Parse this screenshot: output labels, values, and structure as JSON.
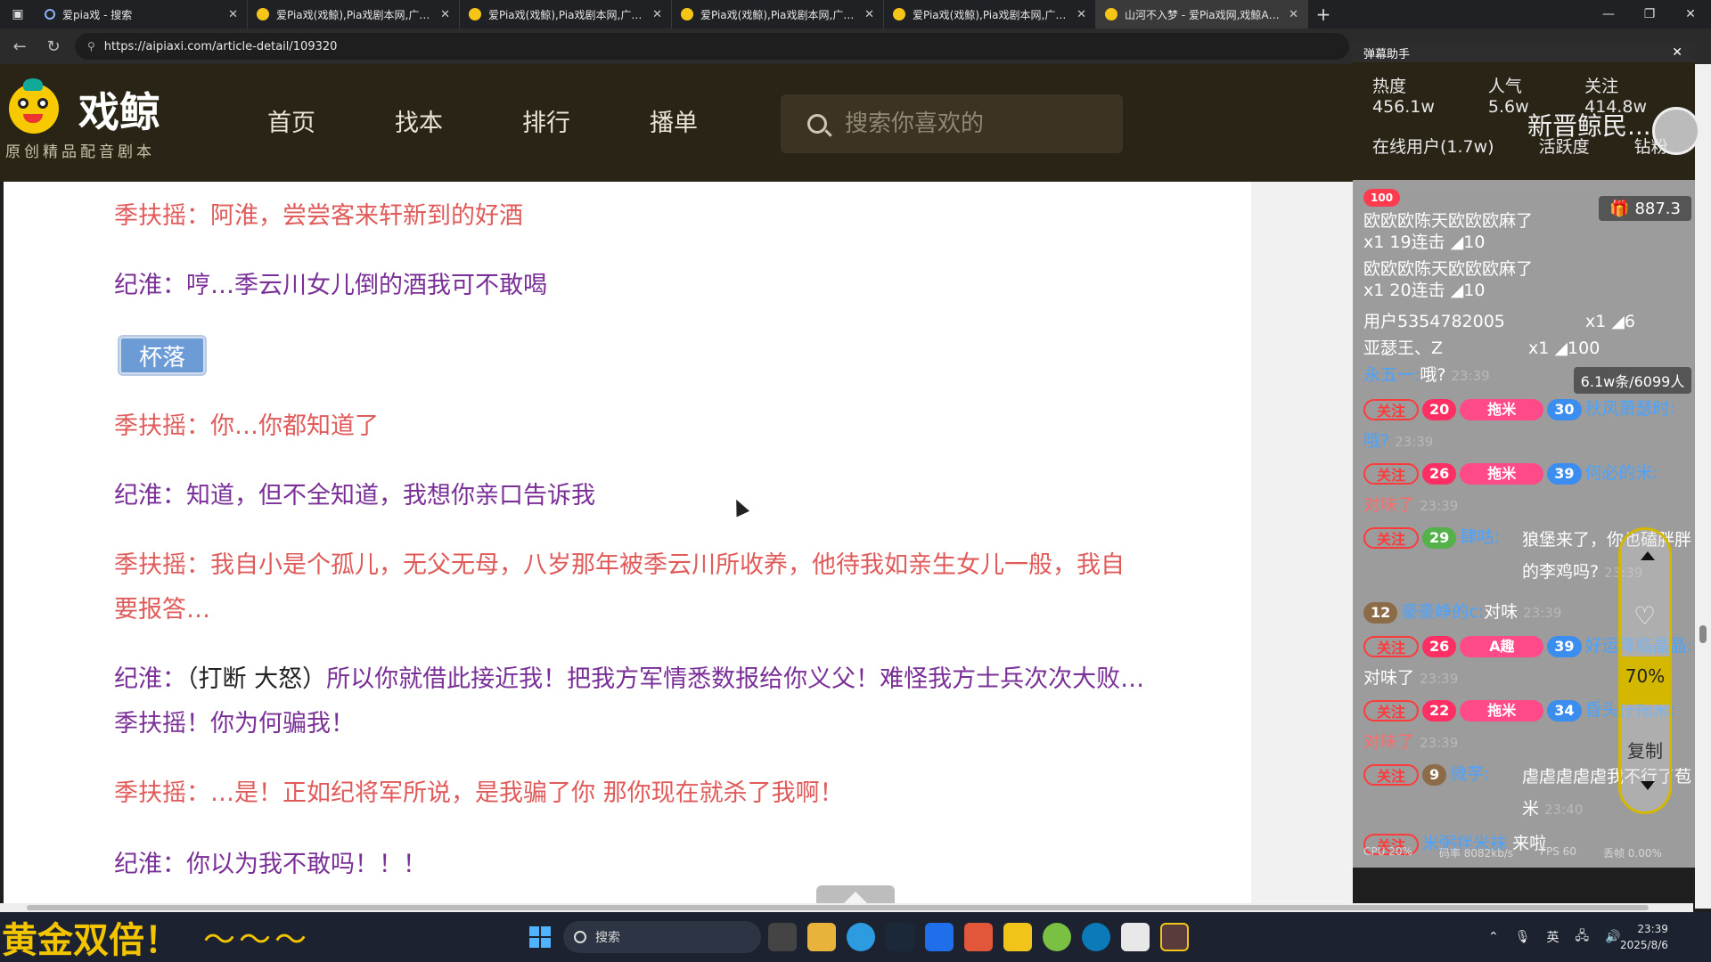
{
  "browser": {
    "tabs": [
      {
        "title": "爱pia戏 - 搜索",
        "active": false,
        "icon": "search-icon"
      },
      {
        "title": "爱Pia戏(戏鲸),Pia戏剧本网,广播剧",
        "active": false,
        "icon": "mascot-icon"
      },
      {
        "title": "爱Pia戏(戏鲸),Pia戏剧本网,广播剧",
        "active": false,
        "icon": "mascot-icon"
      },
      {
        "title": "爱Pia戏(戏鲸),Pia戏剧本网,广播剧",
        "active": false,
        "icon": "mascot-icon"
      },
      {
        "title": "爱Pia戏(戏鲸),Pia戏剧本网,广播剧",
        "active": false,
        "icon": "mascot-icon"
      },
      {
        "title": "山河不入梦 - 爱Pia戏网,戏鲸App,",
        "active": true,
        "icon": "mascot-icon"
      }
    ],
    "url": "https://aipiaxi.com/article-detail/109320"
  },
  "site": {
    "logo_name": "戏鲸",
    "logo_sub": "原创精品配音剧本",
    "nav": [
      "首页",
      "找本",
      "排行",
      "播单"
    ],
    "search_placeholder": "搜索你喜欢的"
  },
  "script_lines": [
    {
      "speaker": "季扶摇：",
      "text": "阿淮，尝尝客来轩新到的好酒",
      "role": "ji"
    },
    {
      "speaker": "纪淮：",
      "text": "哼…季云川女儿倒的酒我可不敢喝",
      "role": "huai"
    },
    {
      "speaker": "季扶摇：",
      "text": "你…你都知道了",
      "role": "ji"
    },
    {
      "speaker": "纪淮：",
      "text": "知道，但不全知道，我想你亲口告诉我",
      "role": "huai"
    },
    {
      "speaker": "季扶摇：",
      "text": "我自小是个孤儿，无父无母，八岁那年被季云川所收养，他待我如亲生女儿一般，我自要报答…",
      "role": "ji"
    },
    {
      "speaker": "纪淮：",
      "direction": "（打断 大怒）",
      "text": "所以你就借此接近我！把我方军情悉数报给你义父！难怪我方士兵次次大败…季扶摇！你为何骗我！",
      "role": "huai"
    },
    {
      "speaker": "季扶摇：",
      "text": "…是！正如纪将军所说，是我骗了你 那你现在就杀了我啊！",
      "role": "ji"
    },
    {
      "speaker": "纪淮：",
      "text": "你以为我不敢吗！！！",
      "role": "huai"
    }
  ],
  "sound_tag": "杯落",
  "danmaku": {
    "title": "弹幕助手",
    "hot": "热度 456.1w",
    "popularity": "人气 5.6w",
    "follow": "关注 414.8w",
    "host": "新晋鲸民...",
    "online": "在线用户(1.7w)",
    "activity": "活跃度",
    "diamond": "钻粉",
    "top_badge": "100",
    "gift_total": "887.3",
    "count_label": "6.1w条/6099人",
    "scroll_pct": "70%",
    "copy_label": "复制",
    "follow_label": "关注",
    "rows": {
      "r1a": "欧欧欧陈天欧欧欧麻了",
      "r1b": "x1 19连击",
      "r1c": "10",
      "r2a": "欧欧欧陈天欧欧欧麻了",
      "r2b": "x1 20连击",
      "r2c": "10",
      "r3a": "用户5354782005",
      "r3b": "x1",
      "r3c": "6",
      "r4a": "亚瑟王、Z",
      "r4b": "x1",
      "r4c": "100",
      "r5a": "永五一:",
      "r5b": "哦?",
      "r5t": "23:39",
      "r6lv": "20",
      "r6fan": "拖米",
      "r6sh": "30",
      "r6n": "秋风萧瑟时:",
      "r6m": "哦?",
      "r6t": "23:39",
      "r7lv": "26",
      "r7fan": "拖米",
      "r7sh": "39",
      "r7n": "何必的米:",
      "r7m": "对味了",
      "r7t": "23:39",
      "r8lv": "29",
      "r8n": "肆咕:",
      "r8m": "狼堡来了，你也磕胖胖的李鸡吗?",
      "r8t": "23:39",
      "r9lv": "12",
      "r9n": "豪豪峥的c:",
      "r9m": "对味",
      "r9t": "23:39",
      "r10lv": "26",
      "r10fan": "A趣",
      "r10sh": "39",
      "r10n": "好运降临晶晶:",
      "r10m": "对味了",
      "r10t": "23:39",
      "r11lv": "22",
      "r11fan": "拖米",
      "r11sh": "34",
      "r11n": "昏头仔拖米:",
      "r11m": "对味了",
      "r11t": "23:39",
      "r12lv": "9",
      "r12n": "微芋:",
      "r12m": "虐虐虐虐虐我不行了苞米",
      "r12t": "23:40",
      "r13n": "米粥拌米袜",
      "r13m": "来啦"
    },
    "footer": [
      "CPU 20%",
      "码率 8082kb/s",
      "FPS 60",
      "丢帧 0.00%"
    ]
  },
  "taskbar": {
    "ticker": "黄金双倍！",
    "ticker_tail": "～～～",
    "search": "搜索",
    "ime": "英",
    "time": "23:39",
    "date": "2025/8/6"
  }
}
